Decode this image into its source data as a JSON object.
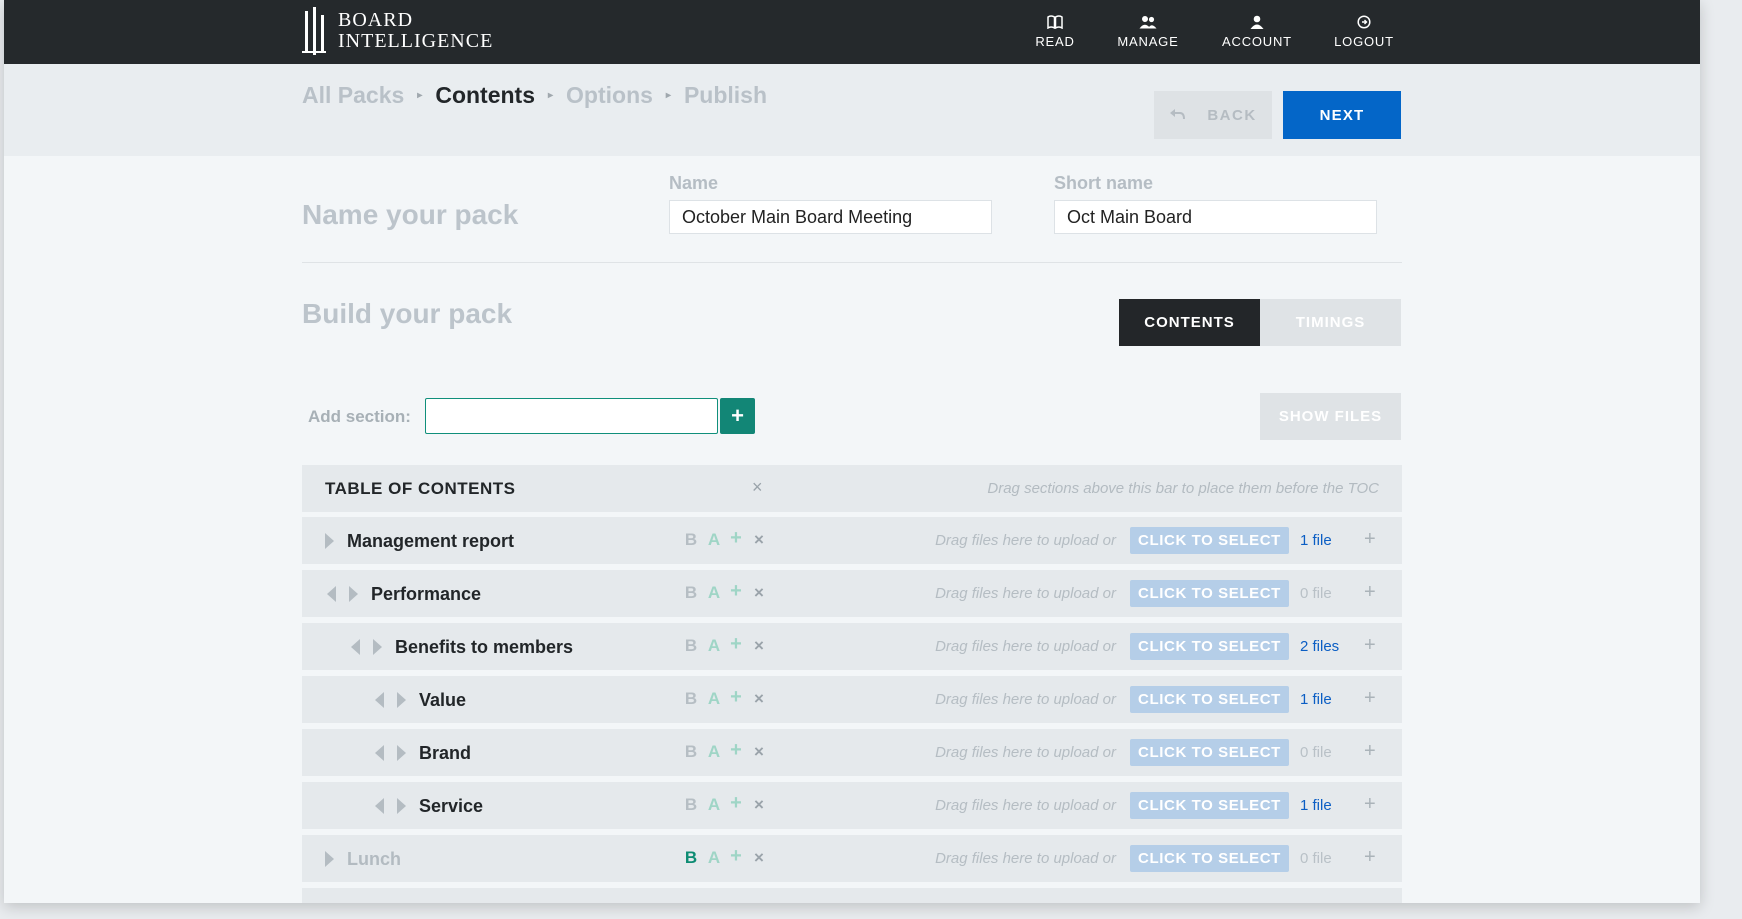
{
  "header": {
    "brand": {
      "line1": "BOARD",
      "line2": "INTELLIGENCE"
    },
    "nav": [
      {
        "label": "READ",
        "icon": "book-icon"
      },
      {
        "label": "MANAGE",
        "icon": "users-icon"
      },
      {
        "label": "ACCOUNT",
        "icon": "user-icon"
      },
      {
        "label": "LOGOUT",
        "icon": "logout-icon"
      }
    ]
  },
  "breadcrumbs": [
    "All Packs",
    "Contents",
    "Options",
    "Publish"
  ],
  "breadcrumb_separator": "▸",
  "actions": {
    "back_label": "BACK",
    "next_label": "NEXT"
  },
  "name_section": {
    "title": "Name your pack",
    "name_label": "Name",
    "name_value": "October Main Board Meeting",
    "short_name_label": "Short name",
    "short_name_value": "Oct Main Board"
  },
  "build_section": {
    "title": "Build your pack",
    "tabs": [
      "CONTENTS",
      "TIMINGS"
    ],
    "add_section_label": "Add section:",
    "add_button": "+",
    "show_files_label": "SHOW FILES"
  },
  "toc": {
    "title": "TABLE OF CONTENTS",
    "remove": "×",
    "hint": "Drag sections above this bar to place them before the TOC"
  },
  "row_controls": {
    "bold": "B",
    "agenda": "A",
    "add": "+",
    "remove": "×"
  },
  "upload_hint": "Drag files here to upload or",
  "select_label": "CLICK TO SELECT",
  "add_file": "+",
  "sections": [
    {
      "title": "Management report",
      "files": "1 file"
    },
    {
      "title": "Performance",
      "files": "0 file"
    },
    {
      "title": "Benefits to members",
      "files": "2 files"
    },
    {
      "title": "Value",
      "files": "1 file"
    },
    {
      "title": "Brand",
      "files": "0 file"
    },
    {
      "title": "Service",
      "files": "1 file"
    },
    {
      "title": "Lunch",
      "files": "0 file"
    }
  ],
  "colors": {
    "accent": "#0466c8",
    "topbar": "#25292c",
    "teal": "#128676"
  }
}
